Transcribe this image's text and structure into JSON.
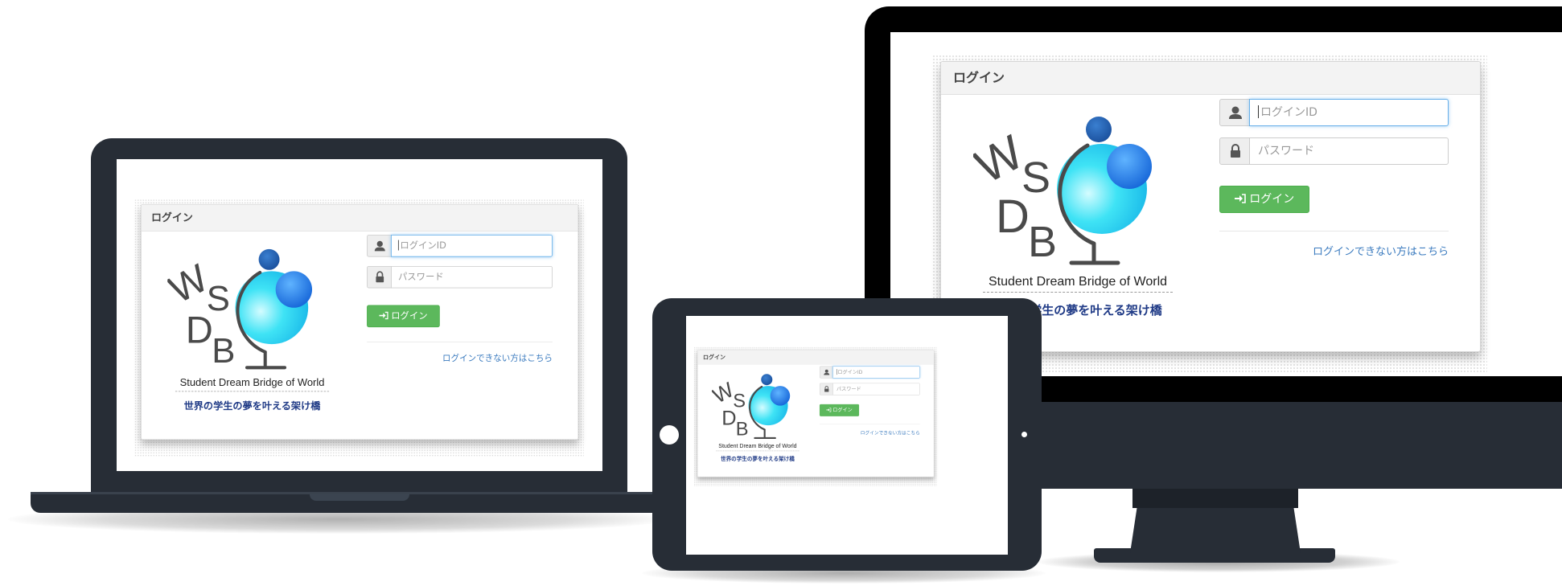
{
  "login": {
    "title": "ログイン",
    "login_id_placeholder": "ログインID",
    "password_placeholder": "パスワード",
    "login_button": "ログイン",
    "forgot_link": "ログインできない方はこちら",
    "tagline_en": "Student Dream Bridge of World",
    "tagline_jp": "世界の学生の夢を叶える架け橋",
    "logo_letters": "SDBW"
  },
  "icons": {
    "user": "user-icon",
    "lock": "lock-icon",
    "sign_in": "sign-in-icon"
  },
  "colors": {
    "device_frame": "#272d36",
    "button_green": "#5cb85c",
    "link_blue": "#3b7bbf",
    "tagline_blue": "#1f3a86",
    "globe_cyan": "#2fd8f2",
    "globe_blue": "#1e7ce8"
  }
}
